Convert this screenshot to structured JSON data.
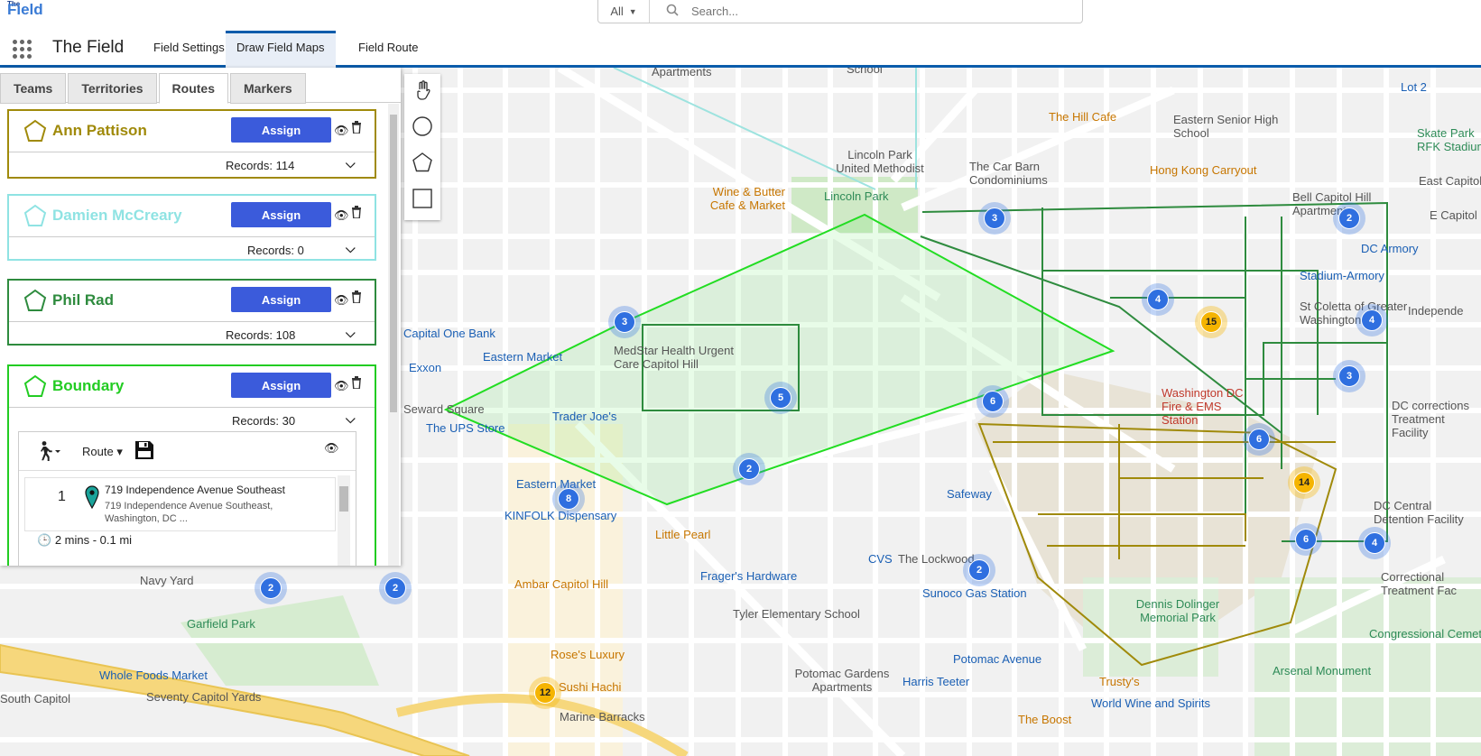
{
  "header": {
    "logo_text_top": "The",
    "logo_text": "Field",
    "search_scope": "All",
    "search_placeholder": "Search..."
  },
  "nav": {
    "app_name": "The Field",
    "tabs": [
      {
        "label": "Field Settings",
        "active": false
      },
      {
        "label": "Draw Field Maps",
        "active": true
      },
      {
        "label": "Field Route",
        "active": false
      }
    ]
  },
  "panel": {
    "tabs": [
      "Teams",
      "Territories",
      "Routes",
      "Markers"
    ],
    "active_tab": "Routes",
    "cards": [
      {
        "name": "Ann Pattison",
        "color": "#a08a0a",
        "assign": "Assign",
        "records": "Records: 114"
      },
      {
        "name": "Damien McCreary",
        "color": "#8fe3e3",
        "assign": "Assign",
        "records": "Records: 0"
      },
      {
        "name": "Phil Rad",
        "color": "#2e8b3e",
        "assign": "Assign",
        "records": "Records: 108"
      },
      {
        "name": "Boundary",
        "color": "#22cc22",
        "assign": "Assign",
        "records": "Records: 30"
      }
    ],
    "route": {
      "mode_icon": "walk-icon",
      "route_label": "Route",
      "stop_number": "1",
      "stop_title": "719 Independence Avenue Southeast",
      "stop_address": "719 Independence Avenue Southeast, Washington, DC ...",
      "leg": "2 mins - 0.1 mi"
    }
  },
  "map": {
    "labels": [
      {
        "text": "Apartments",
        "cls": "ml-gray"
      },
      {
        "text": "School",
        "cls": "ml-gray"
      },
      {
        "text": "Lot 2",
        "cls": "ml-blue"
      },
      {
        "text": "The Hill Cafe",
        "cls": "ml-orange"
      },
      {
        "text": "Eastern Senior High School",
        "cls": "ml-gray"
      },
      {
        "text": "Skate Park RFK Stadium",
        "cls": "ml-green"
      },
      {
        "text": "Lincoln Park United Methodist",
        "cls": "ml-gray"
      },
      {
        "text": "The Car Barn Condominiums",
        "cls": "ml-gray"
      },
      {
        "text": "Hong Kong Carryout",
        "cls": "ml-orange"
      },
      {
        "text": "East Capitol",
        "cls": "ml-gray"
      },
      {
        "text": "Wine & Butter Cafe & Market",
        "cls": "ml-orange"
      },
      {
        "text": "Lincoln Park",
        "cls": "ml-green"
      },
      {
        "text": "Bell Capitol Hill Apartments",
        "cls": "ml-gray"
      },
      {
        "text": "E Capitol S",
        "cls": "ml-gray"
      },
      {
        "text": "DC Armory",
        "cls": "ml-blue"
      },
      {
        "text": "Stadium-Armory",
        "cls": "ml-blue"
      },
      {
        "text": "St Coletta of Greater Washington",
        "cls": "ml-gray"
      },
      {
        "text": "Independe",
        "cls": "ml-gray"
      },
      {
        "text": "Capital One Bank",
        "cls": "ml-blue"
      },
      {
        "text": "Eastern Market",
        "cls": "ml-blue"
      },
      {
        "text": "MedStar Health Urgent Care Capitol Hill",
        "cls": "ml-gray"
      },
      {
        "text": "Exxon",
        "cls": "ml-blue"
      },
      {
        "text": "Seward Square",
        "cls": "ml-gray"
      },
      {
        "text": "Trader Joe's",
        "cls": "ml-blue"
      },
      {
        "text": "The UPS Store",
        "cls": "ml-blue"
      },
      {
        "text": "Washington DC Fire & EMS Station",
        "cls": "ml-red"
      },
      {
        "text": "DC corrections Treatment Facility",
        "cls": "ml-gray"
      },
      {
        "text": "Eastern Market",
        "cls": "ml-blue"
      },
      {
        "text": "KINFOLK Dispensary",
        "cls": "ml-blue"
      },
      {
        "text": "Safeway",
        "cls": "ml-blue"
      },
      {
        "text": "DC Central Detention Facility",
        "cls": "ml-gray"
      },
      {
        "text": "Little Pearl",
        "cls": "ml-orange"
      },
      {
        "text": "Navy Yard",
        "cls": "ml-gray"
      },
      {
        "text": "CVS",
        "cls": "ml-blue"
      },
      {
        "text": "The Lockwood",
        "cls": "ml-gray"
      },
      {
        "text": "Frager's Hardware",
        "cls": "ml-blue"
      },
      {
        "text": "Correctional Treatment Fac",
        "cls": "ml-gray"
      },
      {
        "text": "Ambar Capitol Hill",
        "cls": "ml-orange"
      },
      {
        "text": "Sunoco Gas Station",
        "cls": "ml-blue"
      },
      {
        "text": "Garfield Park",
        "cls": "ml-green"
      },
      {
        "text": "Tyler Elementary School",
        "cls": "ml-gray"
      },
      {
        "text": "Dennis Dolinger Memorial Park",
        "cls": "ml-green"
      },
      {
        "text": "Congressional Cemete",
        "cls": "ml-green"
      },
      {
        "text": "Rose's Luxury",
        "cls": "ml-orange"
      },
      {
        "text": "Whole Foods Market",
        "cls": "ml-blue"
      },
      {
        "text": "Potomac Avenue",
        "cls": "ml-blue"
      },
      {
        "text": "Potomac Gardens Apartments",
        "cls": "ml-gray"
      },
      {
        "text": "Harris Teeter",
        "cls": "ml-blue"
      },
      {
        "text": "Trusty's",
        "cls": "ml-orange"
      },
      {
        "text": "Arsenal Monument",
        "cls": "ml-green"
      },
      {
        "text": "Sushi Hachi",
        "cls": "ml-orange"
      },
      {
        "text": "South Capitol",
        "cls": "ml-gray"
      },
      {
        "text": "Seventy Capitol Yards",
        "cls": "ml-gray"
      },
      {
        "text": "World Wine and Spirits",
        "cls": "ml-blue"
      },
      {
        "text": "Marine Barracks",
        "cls": "ml-gray"
      },
      {
        "text": "The Boost",
        "cls": "ml-orange"
      }
    ],
    "clusters": [
      "3",
      "2",
      "4",
      "15",
      "4",
      "3",
      "6",
      "6",
      "14",
      "2",
      "6",
      "4",
      "2",
      "2",
      "2",
      "8",
      "12",
      "5",
      "3"
    ]
  }
}
